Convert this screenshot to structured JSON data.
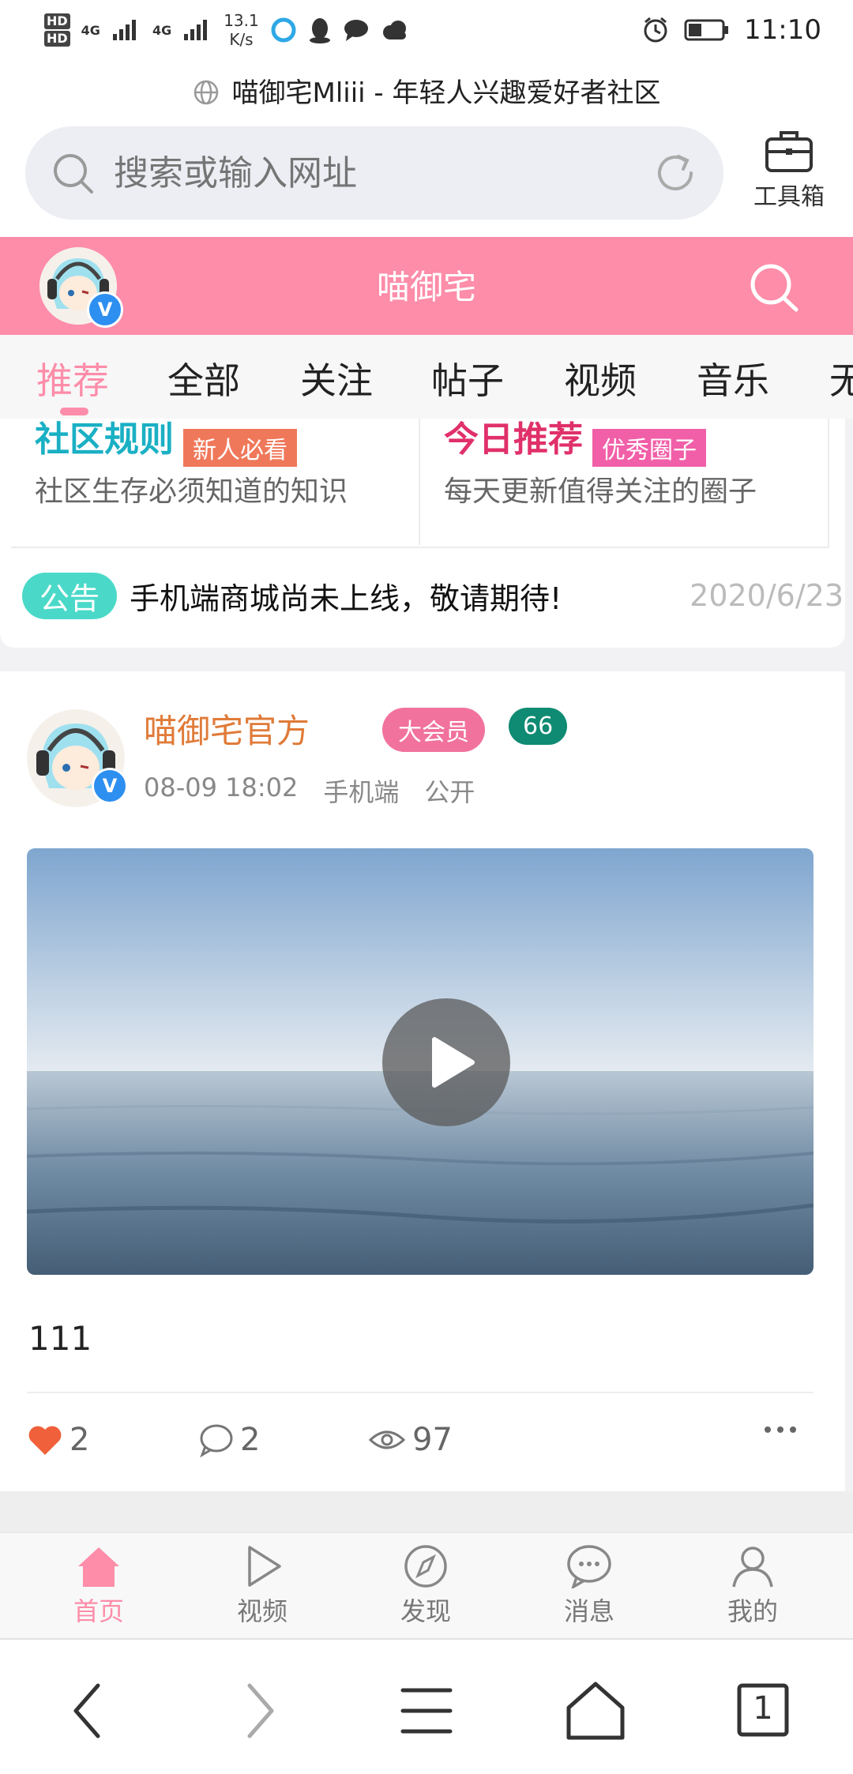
{
  "status_bar": {
    "sim1": "HD",
    "sim2": "HD",
    "net1": "4G",
    "net2": "4G",
    "speed_value": "13.1",
    "speed_unit": "K/s",
    "time": "11:10",
    "icons": [
      "signal-icon",
      "qq-browser-icon",
      "qq-icon",
      "chat-icon",
      "cloud-icon",
      "alarm-icon",
      "battery-icon"
    ]
  },
  "browser": {
    "page_title": "喵御宅Mliii - 年轻人兴趣爱好者社区",
    "search_placeholder": "搜索或输入网址",
    "toolbox_label": "工具箱",
    "tab_count": "1"
  },
  "app_header": {
    "title": "喵御宅",
    "verified_mark": "V"
  },
  "tabs": [
    {
      "label": "推荐",
      "active": true
    },
    {
      "label": "全部",
      "active": false
    },
    {
      "label": "关注",
      "active": false
    },
    {
      "label": "帖子",
      "active": false
    },
    {
      "label": "视频",
      "active": false
    },
    {
      "label": "音乐",
      "active": false
    },
    {
      "label": "无",
      "active": false
    }
  ],
  "features": [
    {
      "title": "社区规则",
      "tag": "新人必看",
      "desc": "社区生存必须知道的知识",
      "title_color": "#1ab0c4",
      "tag_color": "#f0785a"
    },
    {
      "title": "今日推荐",
      "tag": "优秀圈子",
      "desc": "每天更新值得关注的圈子",
      "title_color": "#e0306a",
      "tag_color": "#f15fa8"
    }
  ],
  "notice": {
    "badge": "公告",
    "text": "手机端商城尚未上线，敬请期待!",
    "date": "2020/6/23"
  },
  "post": {
    "author": "喵御宅官方",
    "vip_badge": "大会员",
    "level": "66",
    "time": "08-09 18:02",
    "platform": "手机端",
    "visibility": "公开",
    "text": "111",
    "likes": "2",
    "comments": "2",
    "views": "97"
  },
  "bottom_nav": [
    {
      "label": "首页",
      "icon": "home-icon",
      "active": true
    },
    {
      "label": "视频",
      "icon": "play-icon",
      "active": false
    },
    {
      "label": "发现",
      "icon": "compass-icon",
      "active": false
    },
    {
      "label": "消息",
      "icon": "message-icon",
      "active": false
    },
    {
      "label": "我的",
      "icon": "user-icon",
      "active": false
    }
  ],
  "colors": {
    "brand_pink": "#fd8da9",
    "author_orange": "#e07b39",
    "notice_teal": "#4ad9c8",
    "level_green": "#0f8a73",
    "like_red": "#f0603a"
  }
}
